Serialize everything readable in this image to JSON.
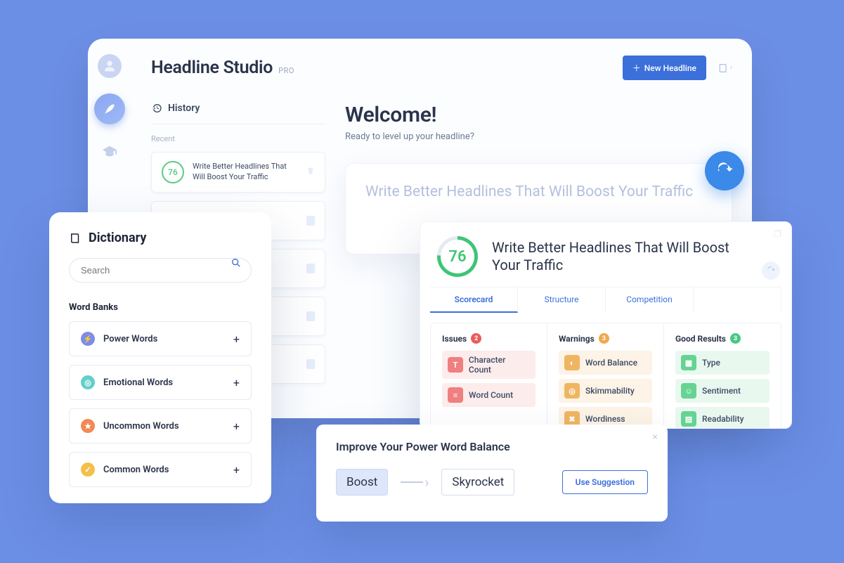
{
  "app": {
    "title": "Headline Studio",
    "badge": "PRO",
    "new_headline": "New Headline"
  },
  "history": {
    "label": "History",
    "recent_label": "Recent",
    "item": {
      "score": "76",
      "title": "Write Better Headlines That Will Boost Your Traffic"
    }
  },
  "welcome": {
    "title": "Welcome!",
    "subtitle": "Ready to level up your headline?",
    "editor_text": "Write Better Headlines That Will Boost Your Traffic"
  },
  "scorecard": {
    "score": "76",
    "headline": "Write Better Headlines That Will Boost Your Traffic",
    "tabs": {
      "score": "Scorecard",
      "structure": "Structure",
      "competition": "Competition"
    },
    "cols": {
      "issues": {
        "label": "Issues",
        "count": "2",
        "items": [
          "Character Count",
          "Word Count"
        ]
      },
      "warnings": {
        "label": "Warnings",
        "count": "3",
        "items": [
          "Word Balance",
          "Skimmability",
          "Wordiness"
        ]
      },
      "good": {
        "label": "Good Results",
        "count": "3",
        "items": [
          "Type",
          "Sentiment",
          "Readability"
        ]
      }
    }
  },
  "suggestion": {
    "title": "Improve Your Power Word Balance",
    "from": "Boost",
    "to": "Skyrocket",
    "button": "Use Suggestion"
  },
  "dictionary": {
    "title": "Dictionary",
    "search_placeholder": "Search",
    "word_banks_label": "Word Banks",
    "banks": {
      "power": "Power Words",
      "emotional": "Emotional Words",
      "uncommon": "Uncommon Words",
      "common": "Common Words"
    }
  }
}
